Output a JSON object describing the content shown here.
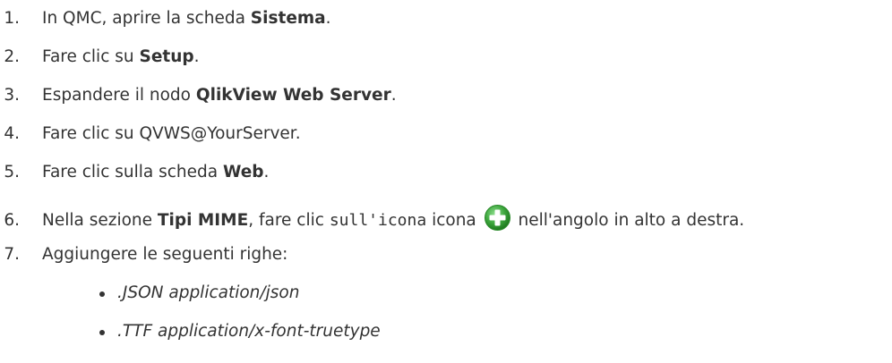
{
  "steps": [
    {
      "num": "1.",
      "pre": "In QMC, aprire la scheda ",
      "bold": "Sistema",
      "post": "."
    },
    {
      "num": "2.",
      "pre": "Fare clic su ",
      "bold": "Setup",
      "post": "."
    },
    {
      "num": "3.",
      "pre": "Espandere il nodo ",
      "bold": "QlikView Web Server",
      "post": "."
    },
    {
      "num": "4.",
      "text": "Fare clic su QVWS@YourServer."
    },
    {
      "num": "5.",
      "pre": "Fare clic sulla scheda ",
      "bold": "Web",
      "post": "."
    },
    {
      "num": "6.",
      "pre": "Nella sezione ",
      "bold": "Tipi MIME",
      "mid": ", fare clic ",
      "code": "sull'icona",
      "post_code": " icona ",
      "post": " nell'angolo in alto a destra."
    },
    {
      "num": "7.",
      "text": "Aggiungere le seguenti righe:"
    }
  ],
  "bullets": [
    ".JSON application/json",
    ".TTF application/x-font-truetype"
  ],
  "icon": {
    "name": "add-icon",
    "color": "#3ca53c"
  }
}
